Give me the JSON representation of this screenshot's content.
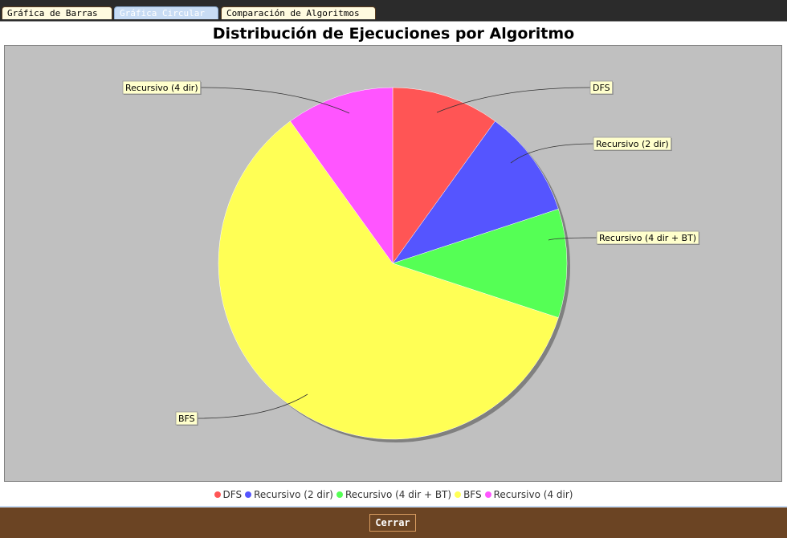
{
  "tabs": [
    {
      "label": "Gráfica de Barras",
      "active": false
    },
    {
      "label": "Gráfica Circular",
      "active": true
    },
    {
      "label": "Comparación de Algoritmos",
      "active": false
    }
  ],
  "footer": {
    "close_label": "Cerrar"
  },
  "chart_data": {
    "type": "pie",
    "title": "Distribución de Ejecuciones por Algoritmo",
    "start_angle_deg": 90,
    "direction": "clockwise",
    "legend_position": "bottom",
    "slices": [
      {
        "label": "DFS",
        "value": 1,
        "color": "#ff5555"
      },
      {
        "label": "Recursivo (2 dir)",
        "value": 1,
        "color": "#5555ff"
      },
      {
        "label": "Recursivo (4 dir + BT)",
        "value": 1,
        "color": "#55ff55"
      },
      {
        "label": "BFS",
        "value": 6,
        "color": "#ffff55"
      },
      {
        "label": "Recursivo (4 dir)",
        "value": 1,
        "color": "#ff55ff"
      }
    ],
    "colors": {
      "plot_background": "#c0c0c0",
      "label_box": "#ffffcc"
    }
  }
}
